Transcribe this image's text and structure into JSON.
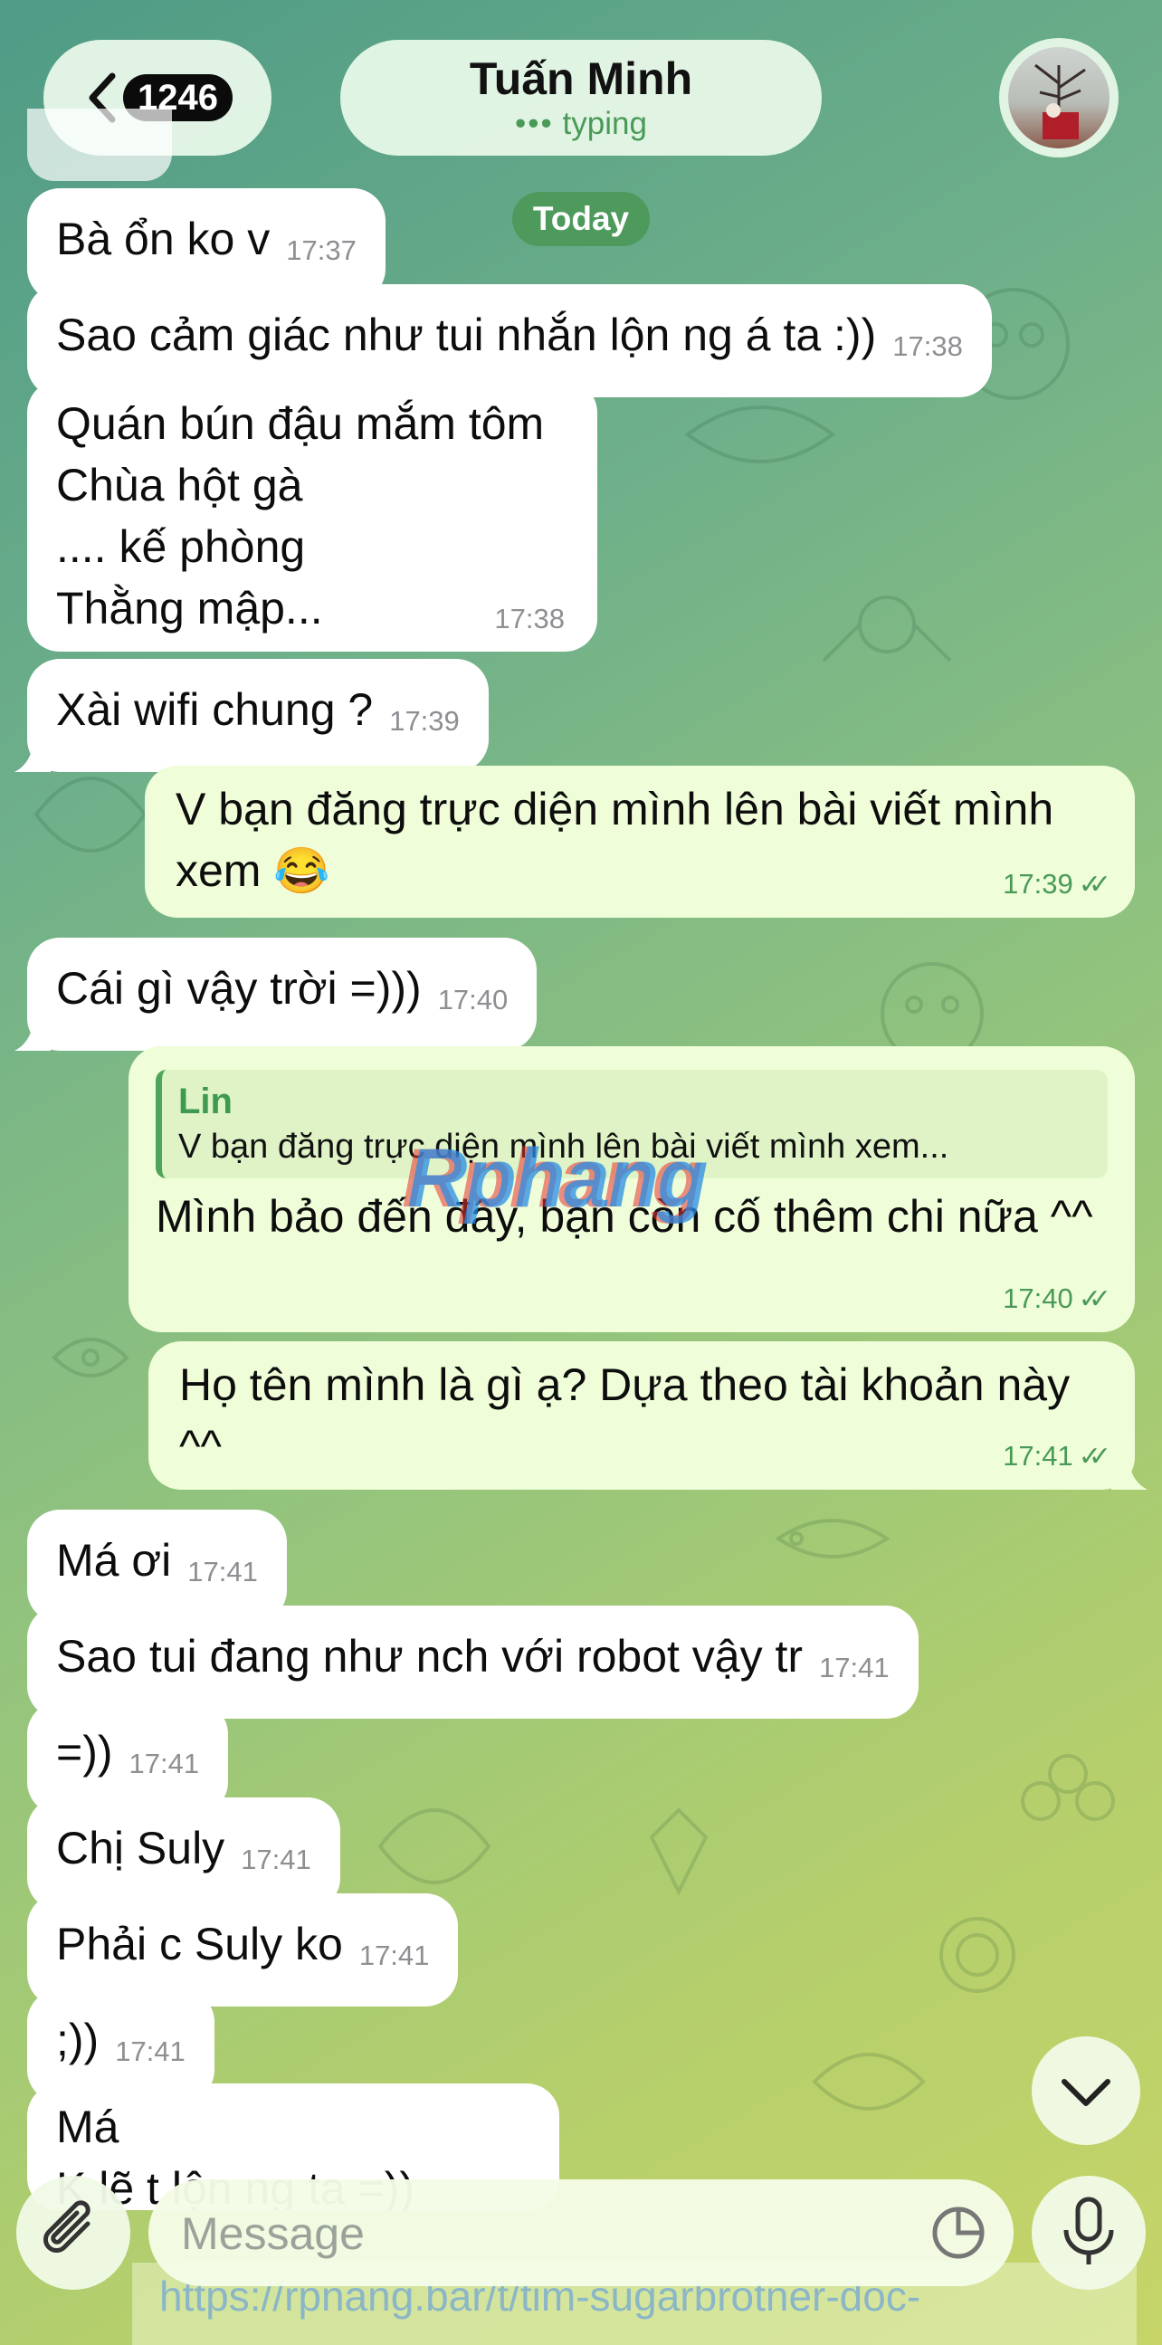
{
  "header": {
    "back_count": "1246",
    "contact_name": "Tuấn Minh",
    "status": "typing",
    "date_badge": "Today"
  },
  "messages": [
    {
      "text": "Bà ổn ko v",
      "time": "17:37"
    },
    {
      "text": "Sao cảm giác như tui nhắn lộn ng á ta :))",
      "time": "17:38"
    },
    {
      "text": "Quán bún đậu mắm tôm\nChùa hột gà\n.... kế phòng\nThằng mập...",
      "time": "17:38"
    },
    {
      "text": "Xài wifi chung ?",
      "time": "17:39"
    },
    {
      "text": "V bạn đăng trực diện mình lên bài viết mình xem 😂",
      "time": "17:39"
    },
    {
      "text": "Cái gì vậy trời =)))",
      "time": "17:40"
    },
    {
      "reply_name": "Lin",
      "reply_text": "V bạn đăng trực diện mình lên bài viết mình xem...",
      "text": "Mình bảo đến đây, bạn còn cố thêm chi nữa ^^",
      "time": "17:40"
    },
    {
      "text": "Họ tên mình là gì ạ? Dựa theo tài khoản này ^^",
      "time": "17:41"
    },
    {
      "text": "Má ơi",
      "time": "17:41"
    },
    {
      "text": "Sao tui đang như nch với robot vậy tr",
      "time": "17:41"
    },
    {
      "text": "=))",
      "time": "17:41"
    },
    {
      "text": "Chị Suly",
      "time": "17:41"
    },
    {
      "text": "Phải c Suly ko",
      "time": "17:41"
    },
    {
      "text": ";))",
      "time": "17:41"
    },
    {
      "text": "Má\nK lẽ t lộn ng ta =))",
      "time": ""
    }
  ],
  "composer": {
    "placeholder": "Message"
  },
  "watermark": {
    "logo_text": "Rphang",
    "url_text": "https://rpnang.bar/t/tim-sugarbrotner-doc-"
  },
  "icons": {
    "back": "chevron-left-icon",
    "attach": "paperclip-icon",
    "sticker": "sticker-icon",
    "mic": "microphone-icon",
    "scroll_down": "chevron-down-icon",
    "read": "double-check-icon"
  },
  "colors": {
    "incoming_bubble": "#ffffff",
    "outgoing_bubble": "#effdd8",
    "accent_green": "#4a9a57",
    "header_pill": "#ebfaeb"
  }
}
